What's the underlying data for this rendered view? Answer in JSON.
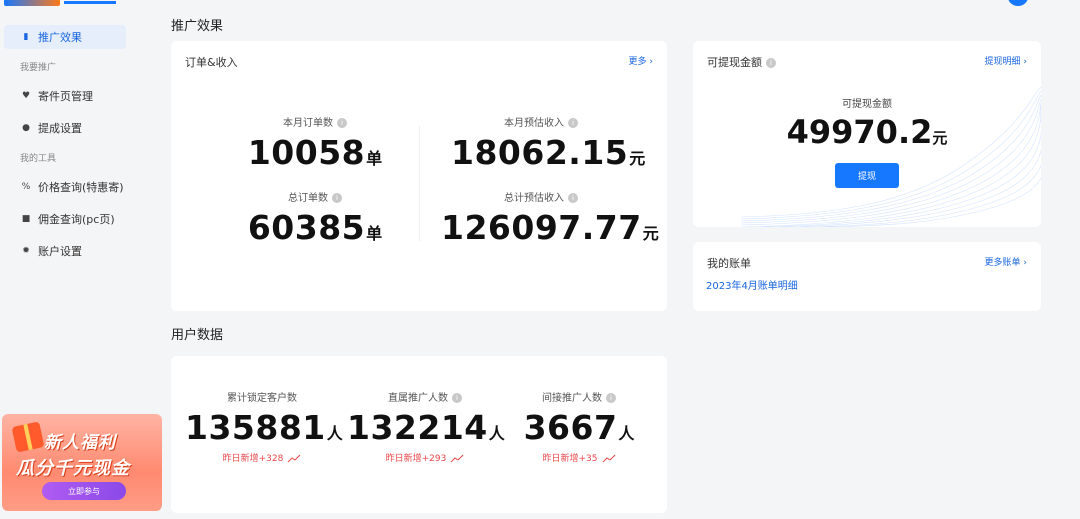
{
  "sidebar": {
    "items": [
      {
        "label": "推广效果",
        "icon": "chart-icon"
      },
      {
        "label": "寄件页管理",
        "icon": "heart-icon"
      },
      {
        "label": "提成设置",
        "icon": "gear-icon"
      },
      {
        "label": "价格查询(特惠寄)",
        "icon": "percent-icon"
      },
      {
        "label": "佣金查询(pc页)",
        "icon": "lock-icon"
      },
      {
        "label": "账户设置",
        "icon": "settings-icon"
      }
    ],
    "groups": [
      "我要推广",
      "我的工具"
    ],
    "promo": {
      "title": "新人福利",
      "subtitle": "瓜分千元现金",
      "button": "立即参与"
    }
  },
  "header": {
    "section_title": "推广效果"
  },
  "orders_card": {
    "title": "订单&收入",
    "more": "更多",
    "stats": [
      {
        "label": "本月订单数",
        "value": "10058",
        "unit": "单"
      },
      {
        "label": "本月预估收入",
        "value": "18062.15",
        "unit": "元"
      },
      {
        "label": "总订单数",
        "value": "60385",
        "unit": "单"
      },
      {
        "label": "总计预估收入",
        "value": "126097.77",
        "unit": "元"
      }
    ]
  },
  "cash_card": {
    "title": "可提现金额",
    "link": "提现明细",
    "label": "可提现金额",
    "value": "49970.2",
    "unit": "元",
    "button": "提现"
  },
  "bill_card": {
    "title": "我的账单",
    "link": "更多账单",
    "item": "2023年4月账单明细"
  },
  "user_section": {
    "title": "用户数据",
    "stats": [
      {
        "label": "累计锁定客户数",
        "value": "135881",
        "unit": "人",
        "growth": "昨日新增+328"
      },
      {
        "label": "直属推广人数",
        "value": "132214",
        "unit": "人",
        "growth": "昨日新增+293"
      },
      {
        "label": "间接推广人数",
        "value": "3667",
        "unit": "人",
        "growth": "昨日新增+35"
      }
    ]
  },
  "colors": {
    "accent": "#1677ff",
    "growth_red": "#e8474a",
    "background": "#f4f5f7"
  }
}
